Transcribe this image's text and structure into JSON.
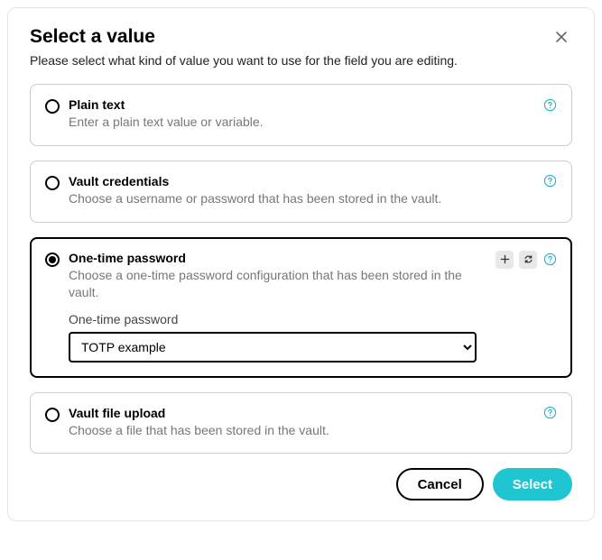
{
  "modal": {
    "title": "Select a value",
    "description": "Please select what kind of value you want to use for the field you are editing."
  },
  "options": {
    "plain_text": {
      "title": "Plain text",
      "desc": "Enter a plain text value or variable."
    },
    "vault_credentials": {
      "title": "Vault credentials",
      "desc": "Choose a username or password that has been stored in the vault."
    },
    "otp": {
      "title": "One-time password",
      "desc": "Choose a one-time password configuration that has been stored in the vault.",
      "field_label": "One-time password",
      "selected_value": "TOTP example"
    },
    "vault_file": {
      "title": "Vault file upload",
      "desc": "Choose a file that has been stored in the vault."
    }
  },
  "buttons": {
    "cancel": "Cancel",
    "select": "Select"
  }
}
